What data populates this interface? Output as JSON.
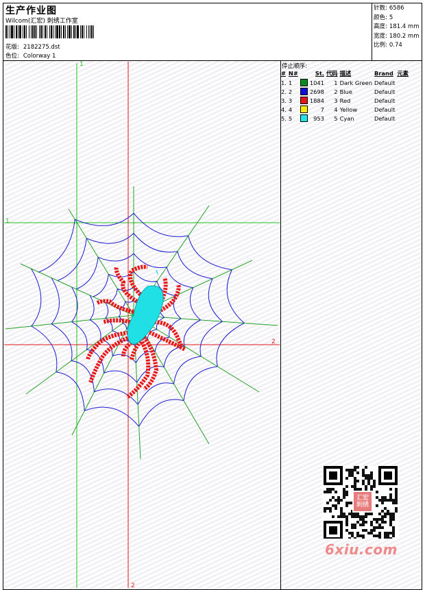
{
  "header": {
    "title": "生产作业图",
    "company": "Wilcom(汇宏) 刺绣工作室",
    "design_label": "花版:",
    "design_file": "2182275.dst",
    "colorway_label": "色位:",
    "colorway": "Colorway 1"
  },
  "stats": [
    {
      "label": "针数:",
      "value": "6586"
    },
    {
      "label": "颜色:",
      "value": "5"
    },
    {
      "label": "高度:",
      "value": "181.4 mm"
    },
    {
      "label": "宽度:",
      "value": "180.2 mm"
    },
    {
      "label": "比例:",
      "value": "0.74"
    }
  ],
  "sequence": {
    "heading": "停止顺序:",
    "columns": [
      "#",
      "N#",
      "St.",
      "代码",
      "描述",
      "Brand",
      "元素"
    ],
    "rows": [
      {
        "idx": "1.",
        "n": "1",
        "color": "#0b8a1e",
        "stitches": "1041",
        "code": "1",
        "desc": "Dark Green",
        "brand": "Default"
      },
      {
        "idx": "2.",
        "n": "2",
        "color": "#1010d8",
        "stitches": "2698",
        "code": "2",
        "desc": "Blue",
        "brand": "Default"
      },
      {
        "idx": "3.",
        "n": "3",
        "color": "#e01818",
        "stitches": "1884",
        "code": "3",
        "desc": "Red",
        "brand": "Default"
      },
      {
        "idx": "4.",
        "n": "4",
        "color": "#f5ea10",
        "stitches": "7",
        "code": "4",
        "desc": "Yellow",
        "brand": "Default"
      },
      {
        "idx": "5.",
        "n": "5",
        "color": "#22e3e8",
        "stitches": "953",
        "code": "5",
        "desc": "Cyan",
        "brand": "Default"
      }
    ]
  },
  "axes": {
    "top_green_label": "1",
    "left_green_label": "1",
    "right_red_label": "2",
    "bottom_red_label": "2"
  },
  "colors": {
    "web_spokes": "#22a022",
    "web_rings": "#1a1ad0",
    "spider_legs": "#e81818",
    "spider_body": "#20e0e6",
    "axis_green": "#22c022",
    "axis_red": "#e01818"
  },
  "qr": {
    "badge": "汇宏刺绣",
    "watermark": "6xiu.com"
  }
}
